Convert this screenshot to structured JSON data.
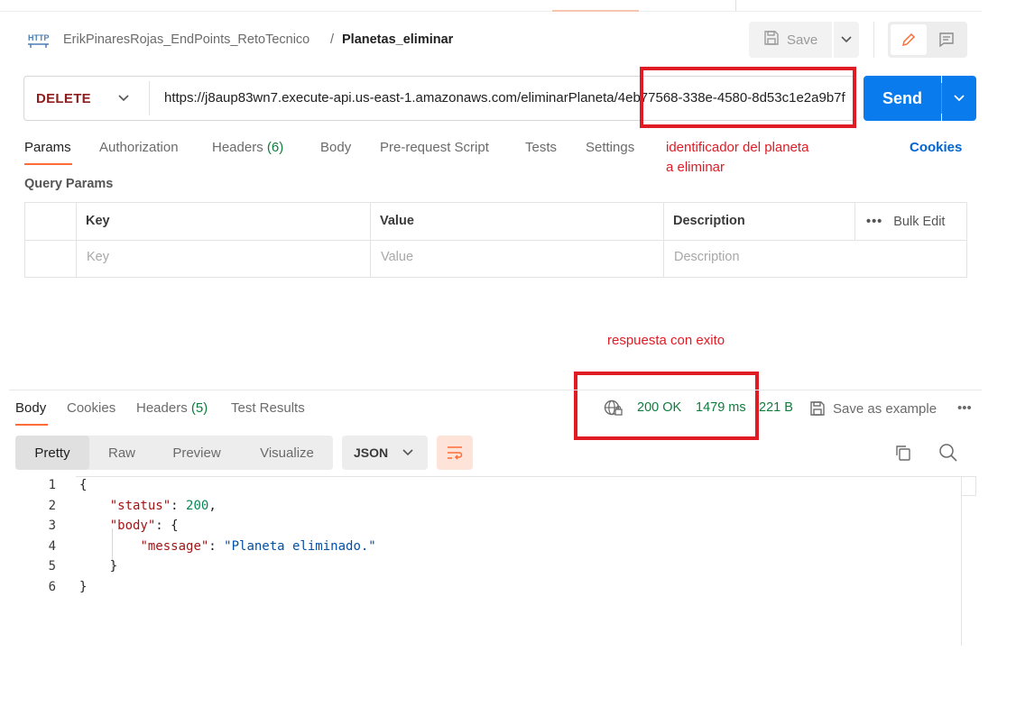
{
  "breadcrumb": {
    "method_icon_text": "HTTP",
    "collection": "ErikPinaresRojas_EndPoints_RetoTecnico",
    "separator": "/",
    "request": "Planetas_eliminar"
  },
  "toolbar": {
    "save_label": "Save"
  },
  "request": {
    "method": "DELETE",
    "url": "https://j8aup83wn7.execute-api.us-east-1.amazonaws.com/eliminarPlaneta/4eb77568-338e-4580-8d53c1e2a9b7f",
    "send_label": "Send"
  },
  "request_tabs": [
    {
      "label": "Params",
      "count": ""
    },
    {
      "label": "Authorization",
      "count": ""
    },
    {
      "label": "Headers",
      "count": "(6)"
    },
    {
      "label": "Body",
      "count": ""
    },
    {
      "label": "Pre-request Script",
      "count": ""
    },
    {
      "label": "Tests",
      "count": ""
    },
    {
      "label": "Settings",
      "count": ""
    }
  ],
  "cookies_label": "Cookies",
  "annotations": {
    "url_note_line1": "identificador del planeta",
    "url_note_line2": "a eliminar",
    "response_note": "respuesta con exito"
  },
  "params": {
    "title": "Query Params",
    "headers": {
      "key": "Key",
      "value": "Value",
      "description": "Description",
      "bulk_edit": "Bulk Edit"
    },
    "placeholders": {
      "key": "Key",
      "value": "Value",
      "description": "Description"
    }
  },
  "response_tabs": [
    {
      "label": "Body",
      "count": ""
    },
    {
      "label": "Cookies",
      "count": ""
    },
    {
      "label": "Headers",
      "count": "(5)"
    },
    {
      "label": "Test Results",
      "count": ""
    }
  ],
  "response_status": {
    "code": "200 OK",
    "time": "1479 ms",
    "size": "221 B",
    "save_example": "Save as example",
    "more": "•••"
  },
  "view_modes": [
    "Pretty",
    "Raw",
    "Preview",
    "Visualize"
  ],
  "format": "JSON",
  "code_lines": [
    {
      "n": "1",
      "p1": "{",
      "key": "",
      "p2": "",
      "val": "",
      "p3": ""
    },
    {
      "n": "2",
      "p1": "    ",
      "key": "\"status\"",
      "p2": ": ",
      "val": "200",
      "p3": ","
    },
    {
      "n": "3",
      "p1": "    ",
      "key": "\"body\"",
      "p2": ": {",
      "val": "",
      "p3": ""
    },
    {
      "n": "4",
      "p1": "        ",
      "key": "\"message\"",
      "p2": ": ",
      "val": "\"Planeta eliminado.\"",
      "p3": ""
    },
    {
      "n": "5",
      "p1": "    }",
      "key": "",
      "p2": "",
      "val": "",
      "p3": ""
    },
    {
      "n": "6",
      "p1": "}",
      "key": "",
      "p2": "",
      "val": "",
      "p3": ""
    }
  ],
  "colors": {
    "accent": "#ff6c37",
    "send": "#097bed",
    "annotation": "#e01b24",
    "status_ok": "#0f7b3d",
    "method_delete": "#8f1d1d"
  }
}
